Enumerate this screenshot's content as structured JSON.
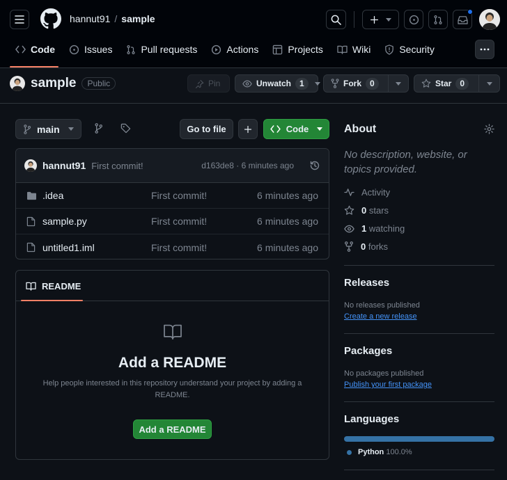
{
  "header": {
    "owner": "hannut91",
    "separator": "/",
    "repo": "sample",
    "notification_dot_color": "#1f6feb"
  },
  "tabs": [
    {
      "label": "Code",
      "icon": "code-icon"
    },
    {
      "label": "Issues",
      "icon": "issue-icon"
    },
    {
      "label": "Pull requests",
      "icon": "pull-request-icon"
    },
    {
      "label": "Actions",
      "icon": "play-icon"
    },
    {
      "label": "Projects",
      "icon": "table-icon"
    },
    {
      "label": "Wiki",
      "icon": "book-icon"
    },
    {
      "label": "Security",
      "icon": "shield-icon"
    }
  ],
  "repo_header": {
    "name": "sample",
    "visibility": "Public",
    "pin_label": "Pin",
    "unwatch_label": "Unwatch",
    "unwatch_count": "1",
    "fork_label": "Fork",
    "fork_count": "0",
    "star_label": "Star",
    "star_count": "0"
  },
  "toolbar": {
    "branch": "main",
    "go_to_file": "Go to file",
    "add_icon": "plus-icon",
    "code_button": "Code",
    "code_button_color": "#238636"
  },
  "latest_commit": {
    "author": "hannut91",
    "message": "First commit!",
    "sha_time": "d163de8 · 6 minutes ago"
  },
  "files": [
    {
      "name": ".idea",
      "type": "folder",
      "message": "First commit!",
      "time": "6 minutes ago"
    },
    {
      "name": "sample.py",
      "type": "file",
      "message": "First commit!",
      "time": "6 minutes ago"
    },
    {
      "name": "untitled1.iml",
      "type": "file",
      "message": "First commit!",
      "time": "6 minutes ago"
    }
  ],
  "readme": {
    "tab_label": "README",
    "title": "Add a README",
    "description_line1": "Help people interested in this repository understand your project by adding a",
    "description_line2": "README.",
    "button": "Add a README"
  },
  "about": {
    "title": "About",
    "description_line1": "No description, website, or",
    "description_line2": "topics provided.",
    "activity": "Activity",
    "stars_count": "0",
    "stars_label": "stars",
    "watching_count": "1",
    "watching_label": "watching",
    "forks_count": "0",
    "forks_label": "forks"
  },
  "releases": {
    "title": "Releases",
    "empty": "No releases published",
    "link": "Create a new release"
  },
  "packages": {
    "title": "Packages",
    "empty": "No packages published",
    "link": "Publish your first package"
  },
  "languages": {
    "title": "Languages",
    "items": [
      {
        "name": "Python",
        "percent": "100.0%",
        "share": 1.0,
        "color": "#3572A5"
      }
    ]
  }
}
